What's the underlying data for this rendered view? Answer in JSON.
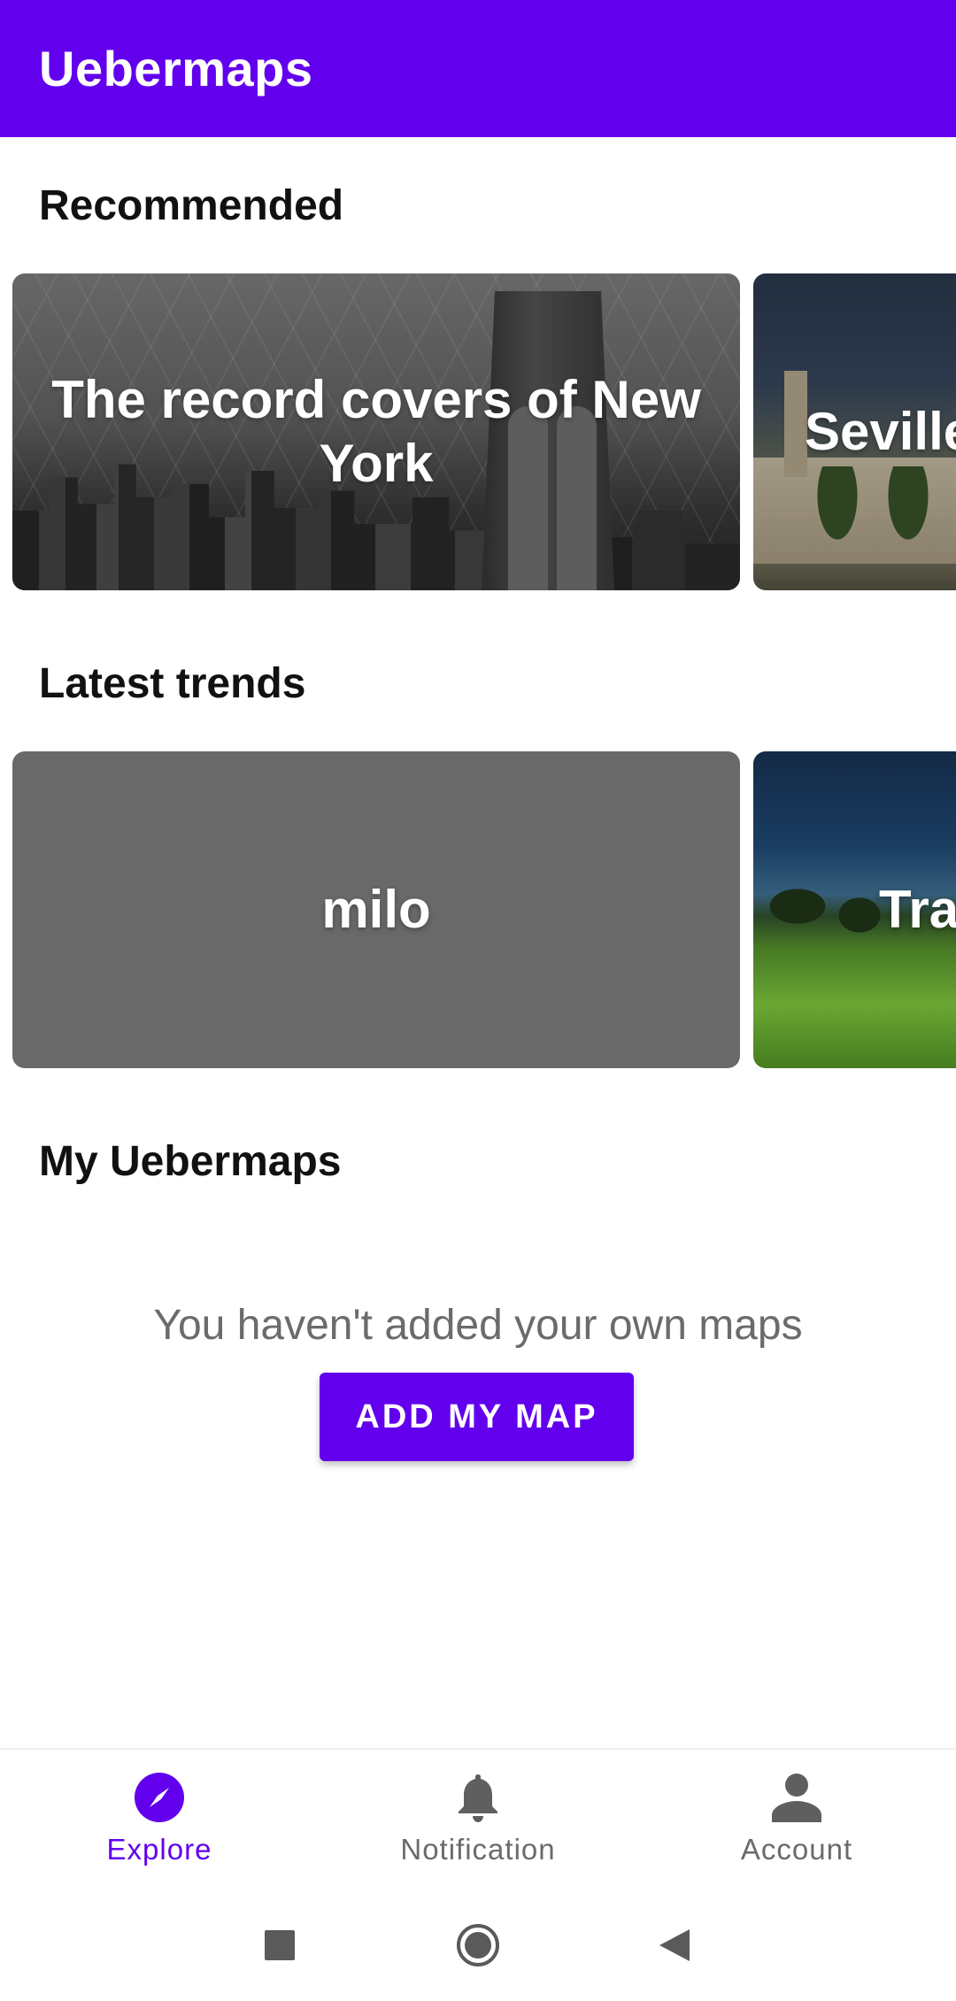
{
  "app_bar": {
    "title": "Uebermaps",
    "color": "#6200ee"
  },
  "sections": {
    "recommended": "Recommended",
    "latest_trends": "Latest trends",
    "my_maps": "My Uebermaps"
  },
  "recommended_cards": [
    {
      "label": "The record covers of New York"
    },
    {
      "label": "Seville"
    }
  ],
  "trend_cards": [
    {
      "label": "milo"
    },
    {
      "label": "Tra"
    }
  ],
  "my_maps": {
    "empty_message": "You haven't added your own maps",
    "add_button": "ADD MY MAP"
  },
  "bottom_nav": {
    "items": [
      {
        "label": "Explore",
        "icon": "compass-icon",
        "active": true
      },
      {
        "label": "Notification",
        "icon": "bell-icon",
        "active": false
      },
      {
        "label": "Account",
        "icon": "person-icon",
        "active": false
      }
    ]
  },
  "system_nav": {
    "buttons": [
      "recents-icon",
      "home-icon",
      "back-icon"
    ]
  }
}
